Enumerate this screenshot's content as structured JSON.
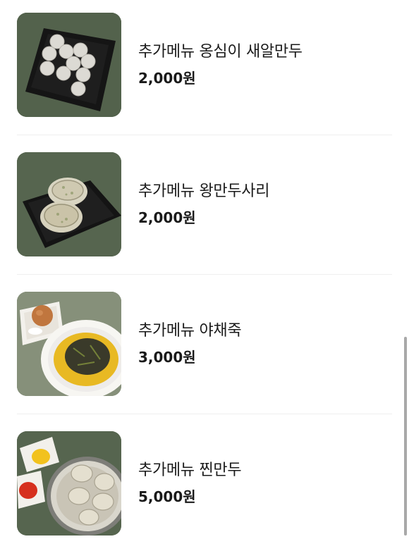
{
  "menu_items": [
    {
      "name": "추가메뉴 옹심이 새알만두",
      "price": "2,000원"
    },
    {
      "name": "추가메뉴 왕만두사리",
      "price": "2,000원"
    },
    {
      "name": "추가메뉴 야채죽",
      "price": "3,000원"
    },
    {
      "name": "추가메뉴 찐만두",
      "price": "5,000원"
    }
  ]
}
